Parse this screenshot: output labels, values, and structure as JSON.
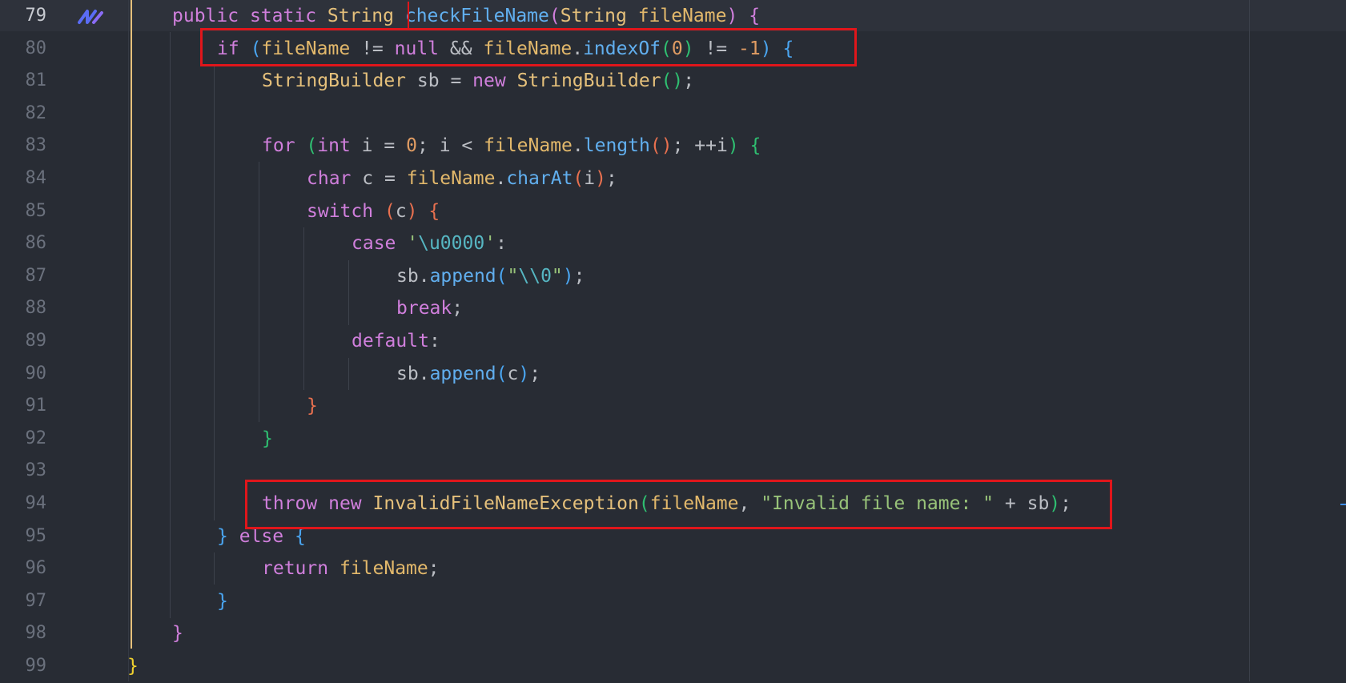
{
  "editor": {
    "language": "java",
    "active_line": 79,
    "highlighted_lines": [
      80,
      94
    ],
    "line_numbers": [
      "79",
      "80",
      "81",
      "82",
      "83",
      "84",
      "85",
      "86",
      "87",
      "88",
      "89",
      "90",
      "91",
      "92",
      "93",
      "94",
      "95",
      "96",
      "97",
      "98",
      "99"
    ],
    "lines": [
      "public static String checkFileName(String fileName) {",
      "if (fileName != null && fileName.indexOf(0) != -1) {",
      "StringBuilder sb = new StringBuilder();",
      "",
      "for (int i = 0; i < fileName.length(); ++i) {",
      "char c = fileName.charAt(i);",
      "switch (c) {",
      "case '\\u0000':",
      "sb.append(\"\\\\0\");",
      "break;",
      "default:",
      "sb.append(c);",
      "}",
      "}",
      "",
      "throw new InvalidFileNameException(fileName, \"Invalid file name: \" + sb);",
      "} else {",
      "return fileName;",
      "}",
      "}",
      "}"
    ],
    "tokens": {
      "l79": [
        "public",
        "static",
        "String",
        "checkFileName",
        "(",
        "String",
        "fileName",
        ")",
        "{"
      ],
      "l80": [
        "if",
        "(",
        "fileName",
        "!=",
        "null",
        "&&",
        "fileName",
        ".",
        "indexOf",
        "(",
        "0",
        ")",
        "!=",
        "-1",
        ")",
        "{"
      ],
      "l81": [
        "StringBuilder",
        "sb",
        "=",
        "new",
        "StringBuilder",
        "()",
        ";"
      ],
      "l83": [
        "for",
        "(",
        "int",
        "i",
        "=",
        "0",
        ";",
        "i",
        "<",
        "fileName",
        ".",
        "length",
        "()",
        ";",
        "++i",
        ")",
        "{"
      ],
      "l84": [
        "char",
        "c",
        "=",
        "fileName",
        ".",
        "charAt",
        "(",
        "i",
        ")",
        ";"
      ],
      "l85": [
        "switch",
        "(",
        "c",
        ")",
        "{"
      ],
      "l86": [
        "case",
        "'",
        "\\u0000",
        "'",
        ":"
      ],
      "l87": [
        "sb",
        ".",
        "append",
        "(",
        "\"",
        "\\\\0",
        "\"",
        ")",
        ";"
      ],
      "l88": [
        "break",
        ";"
      ],
      "l89": [
        "default",
        ":"
      ],
      "l90": [
        "sb",
        ".",
        "append",
        "(",
        "c",
        ")",
        ";"
      ],
      "l91": [
        "}"
      ],
      "l92": [
        "}"
      ],
      "l94": [
        "throw",
        "new",
        "InvalidFileNameException",
        "(",
        "fileName",
        ",",
        "\"Invalid file name: \"",
        "+",
        "sb",
        ")",
        ";"
      ],
      "l95": [
        "}",
        "else",
        "{"
      ],
      "l96": [
        "return",
        "fileName",
        ";"
      ],
      "l97": [
        "}"
      ],
      "l98": [
        "}"
      ],
      "l99": [
        "}"
      ]
    }
  },
  "colors": {
    "background": "#282c34",
    "highlight_box": "#e0161b",
    "keyword": "#d07fdc",
    "type": "#e5c07b",
    "function": "#61afef",
    "string": "#98c379",
    "number": "#e09c63"
  },
  "icons": {
    "gutter_icon": "ai-assistant-icon"
  }
}
